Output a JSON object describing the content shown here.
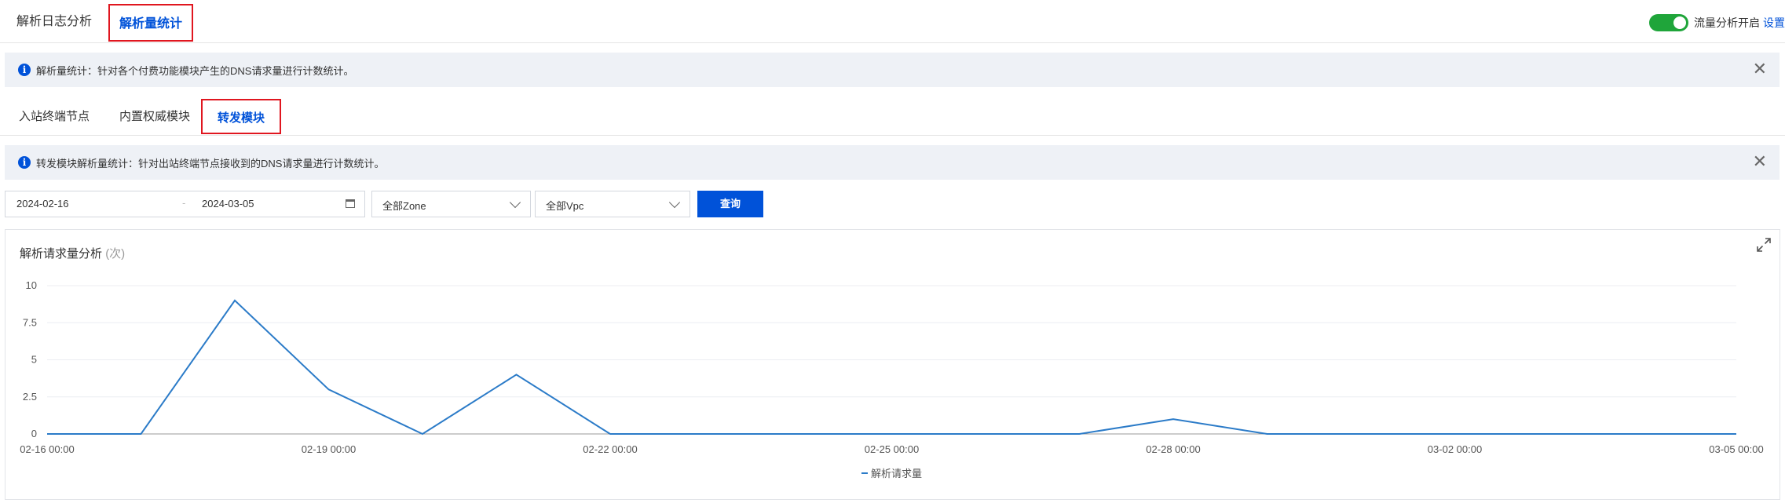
{
  "top_tabs": [
    {
      "label": "解析日志分析",
      "active": false
    },
    {
      "label": "解析量统计",
      "active": true
    }
  ],
  "flow_analysis": {
    "label": "流量分析开启",
    "link": "设置",
    "enabled": true
  },
  "notice1": {
    "text": "解析量统计：针对各个付费功能模块产生的DNS请求量进行计数统计。"
  },
  "sub_tabs": [
    {
      "label": "入站终端节点",
      "active": false
    },
    {
      "label": "内置权威模块",
      "active": false
    },
    {
      "label": "转发模块",
      "active": true
    }
  ],
  "notice2": {
    "text": "转发模块解析量统计：针对出站终端节点接收到的DNS请求量进行计数统计。"
  },
  "filters": {
    "start_date": "2024-02-16",
    "separator": "-",
    "end_date": "2024-03-05",
    "zone_select": "全部Zone",
    "vpc_select": "全部Vpc",
    "query_button": "查询"
  },
  "chart_title": {
    "text": "解析请求量分析",
    "unit": "(次)"
  },
  "colors": {
    "accent": "#0052d9",
    "toggle_on": "#1fa53a",
    "series": "#2b7bc8",
    "highlight_box": "#e0161f"
  },
  "chart_data": {
    "type": "line",
    "title": "解析请求量分析 (次)",
    "x": [
      "02-16",
      "02-17",
      "02-18",
      "02-19",
      "02-20",
      "02-21",
      "02-22",
      "02-23",
      "02-24",
      "02-25",
      "02-26",
      "02-27",
      "02-28",
      "02-29",
      "03-01",
      "03-02",
      "03-03",
      "03-04",
      "03-05"
    ],
    "x_tick_labels": [
      "02-16 00:00",
      "02-19 00:00",
      "02-22 00:00",
      "02-25 00:00",
      "02-28 00:00",
      "03-02 00:00",
      "03-05 00:00"
    ],
    "y_tick_labels": [
      "0",
      "2.5",
      "5",
      "7.5",
      "10"
    ],
    "ylim": [
      0,
      10
    ],
    "series": [
      {
        "name": "解析请求量",
        "values": [
          0,
          0,
          9,
          3,
          0,
          4,
          0,
          0,
          0,
          0,
          0,
          0,
          1,
          0,
          0,
          0,
          0,
          0,
          0
        ]
      }
    ],
    "grid": true,
    "legend": "bottom-center"
  }
}
